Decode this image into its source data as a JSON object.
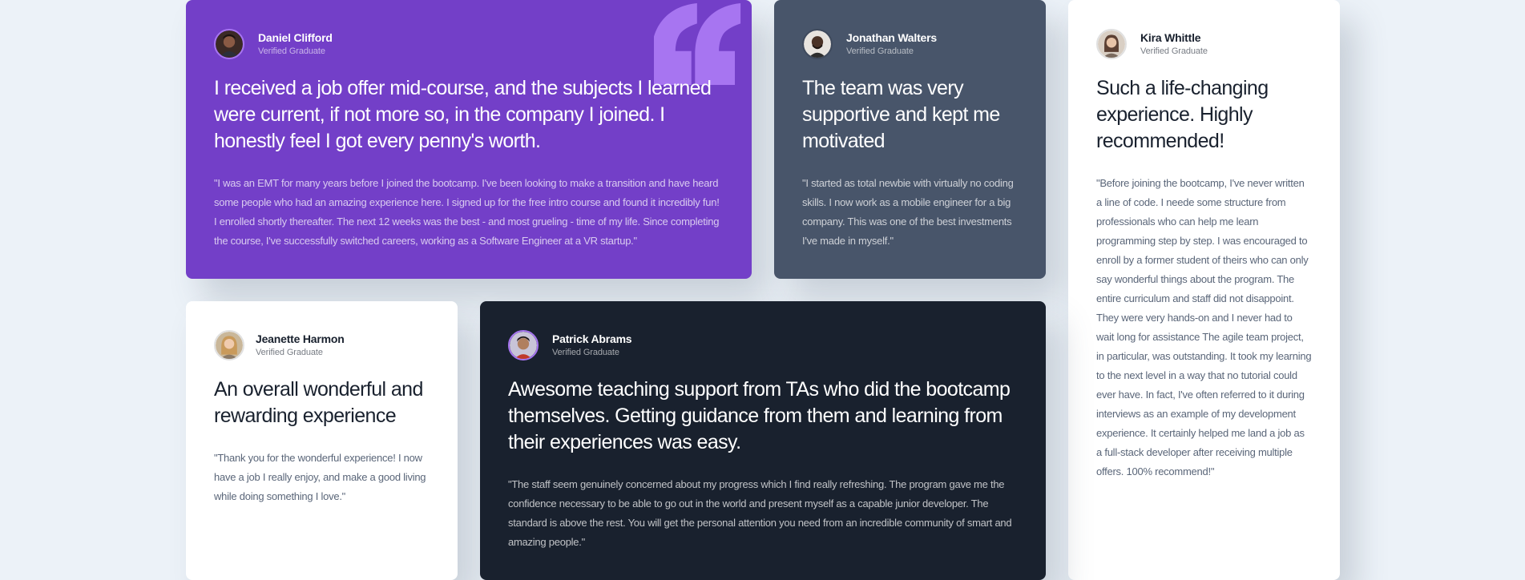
{
  "colors": {
    "background": "#ECF2F8",
    "moderate_violet": "#733FC8",
    "grayish_blue": "#48556A",
    "very_dark_blackish_blue": "#19212E",
    "white": "#FFFFFF",
    "light_violet": "#A775F1"
  },
  "icons": {
    "quote": "quotation-mark-icon"
  },
  "testimonials": [
    {
      "name": "Daniel Clifford",
      "role": "Verified Graduate",
      "title": "I received a job offer mid-course, and the subjects I learned were current, if not more so, in the company I joined. I honestly feel I got every penny's worth.",
      "body": "\"I was an EMT for many years before I joined the bootcamp. I've been looking to make a transition and have heard some people who had an amazing experience here. I signed up for the free intro course and found it incredibly fun! I enrolled shortly thereafter. The next 12 weeks was the best - and most grueling - time of my life. Since completing the course, I've successfully switched careers, working as a Software Engineer at a VR startup.\""
    },
    {
      "name": "Jonathan Walters",
      "role": "Verified Graduate",
      "title": "The team was very supportive and kept me motivated",
      "body": "\"I started as total newbie with virtually no coding skills. I now work as a mobile engineer for a big company. This was one of the best investments I've made in myself.\""
    },
    {
      "name": "Kira Whittle",
      "role": "Verified Graduate",
      "title": "Such a life-changing experience. Highly recommended!",
      "body": "\"Before joining the bootcamp, I've never written a line of code. I neede some structure from professionals who can help me learn programming step by step. I was encouraged to enroll by a former student of theirs who can only say wonderful things about the program. The entire curriculum and staff did not disappoint. They were very hands-on and I never had to wait long for assistance The agile team project, in particular, was outstanding. It took my learning to the next level in a way that no tutorial could ever have. In fact, I've often referred to it during interviews as an example of my development experience. It certainly helped me land a job as a full-stack developer after receiving multiple offers. 100% recommend!\""
    },
    {
      "name": "Jeanette Harmon",
      "role": "Verified Graduate",
      "title": "An overall wonderful and rewarding experience",
      "body": "\"Thank you for the wonderful experience! I now have a job I really enjoy, and make a good living while doing something I love.\""
    },
    {
      "name": "Patrick Abrams",
      "role": "Verified Graduate",
      "title": "Awesome teaching support from TAs who did the bootcamp themselves. Getting guidance from them and learning from their experiences was easy.",
      "body": "\"The staff seem genuinely concerned about my progress which I find really refreshing. The program gave me the confidence necessary to be able to go out in the world and present myself as a capable junior developer. The standard is above the rest. You will get the personal attention you need from an incredible community of smart and amazing people.\""
    }
  ]
}
